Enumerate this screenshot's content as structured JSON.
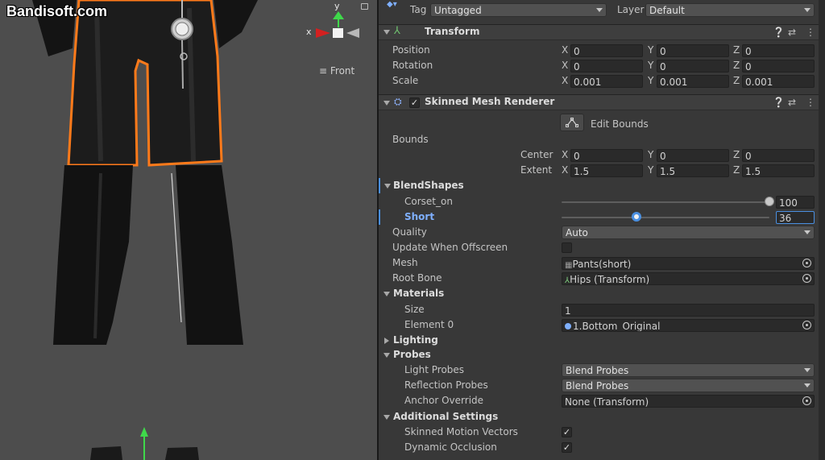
{
  "watermark": "Bandisoft.com",
  "scene": {
    "gizmo": {
      "y_label": "y",
      "x_label": "x"
    },
    "view_label": "Front",
    "view_icon": "hamburger-icon"
  },
  "header": {
    "tag_label": "Tag",
    "tag_value": "Untagged",
    "layer_label": "Layer",
    "layer_value": "Default"
  },
  "transform": {
    "title": "Transform",
    "rows": [
      {
        "label": "Position",
        "x": "0",
        "y": "0",
        "z": "0"
      },
      {
        "label": "Rotation",
        "x": "0",
        "y": "0",
        "z": "0"
      },
      {
        "label": "Scale",
        "x": "0.001",
        "y": "0.001",
        "z": "0.001"
      }
    ]
  },
  "smr": {
    "title": "Skinned Mesh Renderer",
    "enabled": "✓",
    "edit_bounds": "Edit Bounds",
    "bounds_label": "Bounds",
    "center": {
      "label": "Center",
      "x": "0",
      "y": "0",
      "z": "0"
    },
    "extent": {
      "label": "Extent",
      "x": "1.5",
      "y": "1.5",
      "z": "1.5"
    },
    "blendshapes": {
      "label": "BlendShapes",
      "items": [
        {
          "label": "Corset_on",
          "value": "100",
          "level": 1.0
        },
        {
          "label": "Short",
          "value": "36",
          "level": 0.36
        }
      ]
    },
    "quality": {
      "label": "Quality",
      "value": "Auto"
    },
    "update_offscreen": {
      "label": "Update When Offscreen",
      "checked": ""
    },
    "mesh": {
      "label": "Mesh",
      "value": "Pants(short)"
    },
    "root_bone": {
      "label": "Root Bone",
      "value": "Hips (Transform)"
    },
    "materials": {
      "label": "Materials",
      "size_label": "Size",
      "size_value": "1",
      "element_label": "Element 0",
      "element_value": "1.Bottom_Original"
    },
    "lighting": {
      "label": "Lighting"
    },
    "probes": {
      "label": "Probes",
      "light_label": "Light Probes",
      "light_value": "Blend Probes",
      "reflection_label": "Reflection Probes",
      "reflection_value": "Blend Probes",
      "anchor_label": "Anchor Override",
      "anchor_value": "None (Transform)"
    },
    "additional": {
      "label": "Additional Settings",
      "motion_label": "Skinned Motion Vectors",
      "motion_checked": "✓",
      "occlusion_label": "Dynamic Occlusion",
      "occlusion_checked": "✓"
    }
  },
  "axis_labels": {
    "x": "X",
    "y": "Y",
    "z": "Z"
  },
  "colors": {
    "selection_outline": "#ff7a1a",
    "gizmo_x": "#d42020",
    "gizmo_y": "#3fd84a",
    "accent_blue": "#7fb0ff",
    "scene_bg": "#4d4d4d",
    "inspector_bg": "#383838"
  }
}
